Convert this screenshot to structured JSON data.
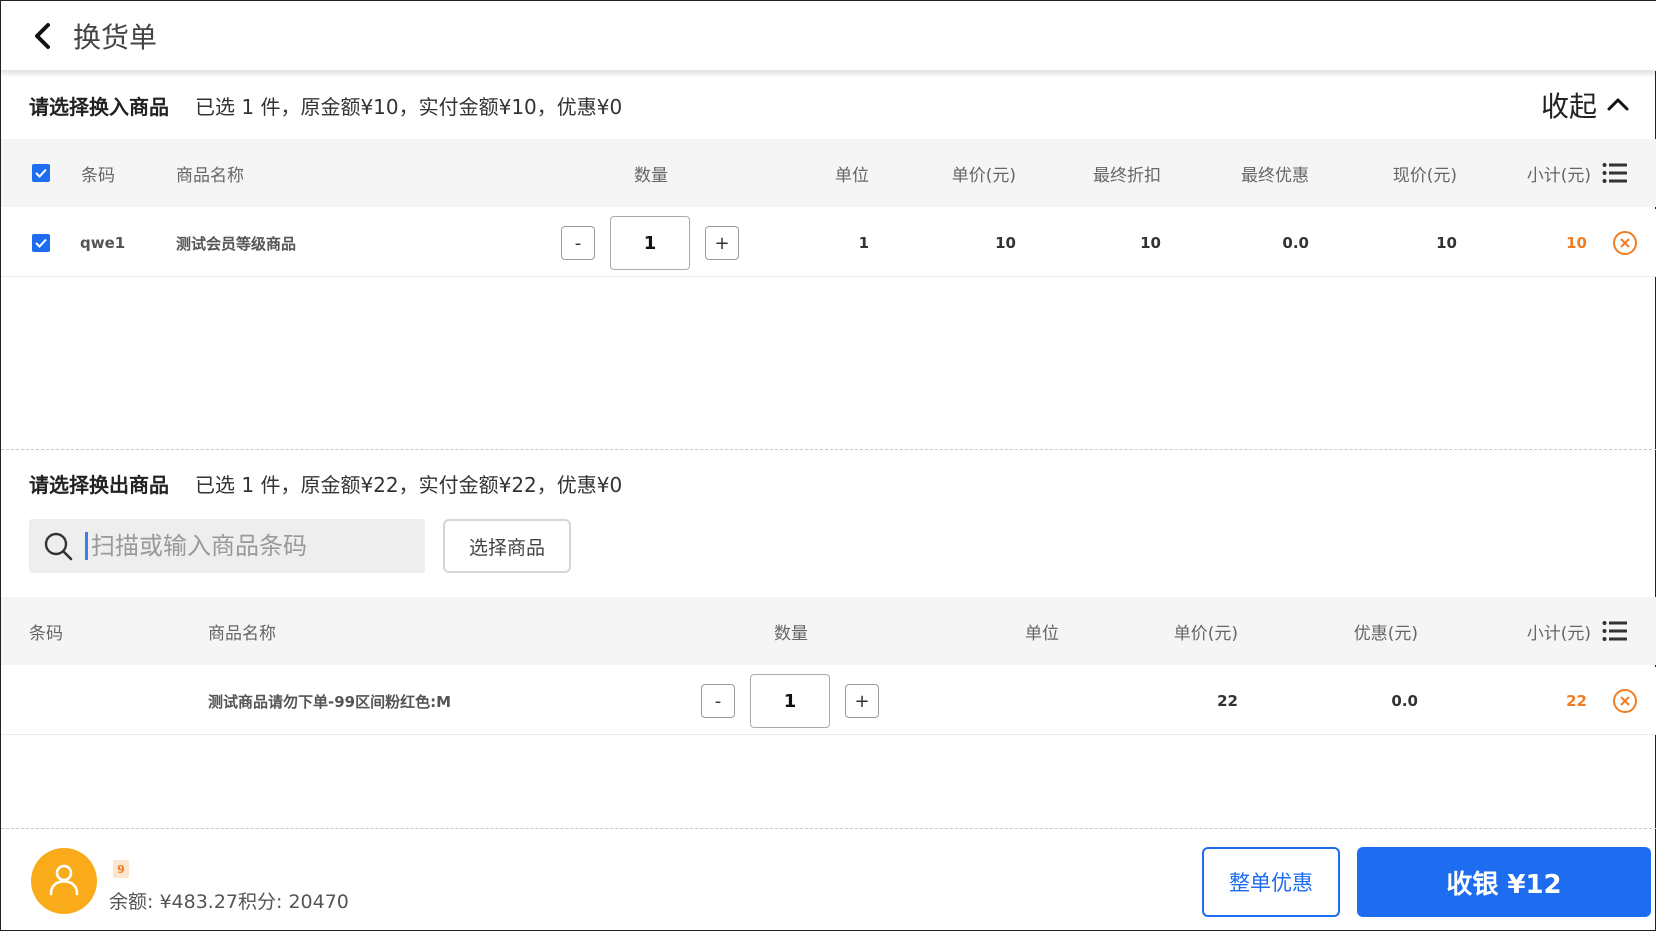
{
  "header": {
    "title": "换货单"
  },
  "exchange_in": {
    "title": "请选择换入商品",
    "summary": "已选 1 件，原金额¥10，实付金额¥10，优惠¥0",
    "collapse_label": "收起",
    "columns": {
      "barcode": "条码",
      "name": "商品名称",
      "qty": "数量",
      "unit": "单位",
      "price": "单价(元)",
      "final_discount": "最终折扣",
      "final_offer": "最终优惠",
      "current_price": "现价(元)",
      "subtotal": "小计(元)"
    },
    "rows": [
      {
        "barcode": "qwe1",
        "name": "测试会员等级商品",
        "qty": "1",
        "unit": "1",
        "price": "10",
        "final_discount": "10",
        "final_offer": "0.0",
        "current_price": "10",
        "subtotal": "10"
      }
    ]
  },
  "exchange_out": {
    "title": "请选择换出商品",
    "summary": "已选 1 件，原金额¥22，实付金额¥22，优惠¥0",
    "search_placeholder": "扫描或输入商品条码",
    "select_button": "选择商品",
    "columns": {
      "barcode": "条码",
      "name": "商品名称",
      "qty": "数量",
      "unit": "单位",
      "price": "单价(元)",
      "offer": "优惠(元)",
      "subtotal": "小计(元)"
    },
    "rows": [
      {
        "barcode": "",
        "name": "测试商品请勿下单-99区间粉红色:M",
        "qty": "1",
        "unit": "",
        "price": "22",
        "offer": "0.0",
        "subtotal": "22"
      }
    ]
  },
  "stepper": {
    "minus": "-",
    "plus": "+"
  },
  "footer": {
    "member_level": "9",
    "balance_text": "余额: ¥483.27积分: 20470",
    "discount_button": "整单优惠",
    "checkout_button": "收银 ¥12"
  },
  "colors": {
    "primary": "#1e6df0",
    "accent": "#f07d24",
    "avatar": "#f9ab1a"
  },
  "icons": [
    "back-arrow-icon",
    "chevron-up-icon",
    "check-icon",
    "list-icon",
    "remove-circle-icon",
    "search-icon",
    "user-icon"
  ]
}
